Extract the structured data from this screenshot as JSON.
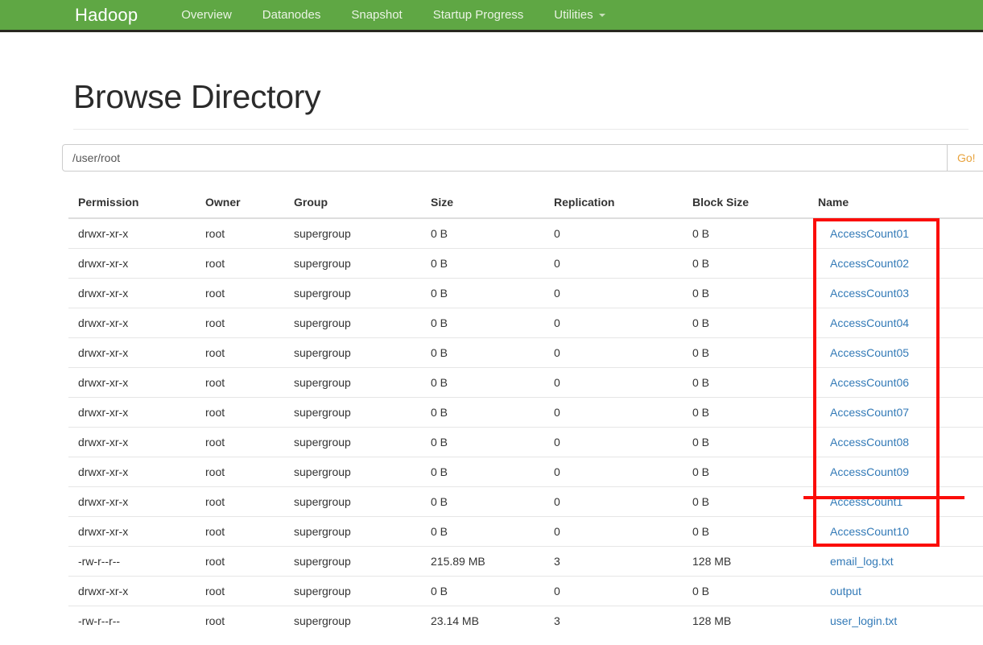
{
  "navbar": {
    "brand": "Hadoop",
    "items": [
      {
        "label": "Overview",
        "caret": false
      },
      {
        "label": "Datanodes",
        "caret": false
      },
      {
        "label": "Snapshot",
        "caret": false
      },
      {
        "label": "Startup Progress",
        "caret": false
      },
      {
        "label": "Utilities",
        "caret": true
      }
    ],
    "background_color": "#5fa744",
    "text_color": "#eaf3e4"
  },
  "page": {
    "title": "Browse Directory"
  },
  "path_bar": {
    "value": "/user/root",
    "placeholder": "",
    "go_button_label": "Go!"
  },
  "table": {
    "headers": [
      "Permission",
      "Owner",
      "Group",
      "Size",
      "Replication",
      "Block Size",
      "Name"
    ],
    "rows": [
      {
        "permission": "drwxr-xr-x",
        "owner": "root",
        "group": "supergroup",
        "size": "0 B",
        "replication": "0",
        "block_size": "0 B",
        "name": "AccessCount01"
      },
      {
        "permission": "drwxr-xr-x",
        "owner": "root",
        "group": "supergroup",
        "size": "0 B",
        "replication": "0",
        "block_size": "0 B",
        "name": "AccessCount02"
      },
      {
        "permission": "drwxr-xr-x",
        "owner": "root",
        "group": "supergroup",
        "size": "0 B",
        "replication": "0",
        "block_size": "0 B",
        "name": "AccessCount03"
      },
      {
        "permission": "drwxr-xr-x",
        "owner": "root",
        "group": "supergroup",
        "size": "0 B",
        "replication": "0",
        "block_size": "0 B",
        "name": "AccessCount04"
      },
      {
        "permission": "drwxr-xr-x",
        "owner": "root",
        "group": "supergroup",
        "size": "0 B",
        "replication": "0",
        "block_size": "0 B",
        "name": "AccessCount05"
      },
      {
        "permission": "drwxr-xr-x",
        "owner": "root",
        "group": "supergroup",
        "size": "0 B",
        "replication": "0",
        "block_size": "0 B",
        "name": "AccessCount06"
      },
      {
        "permission": "drwxr-xr-x",
        "owner": "root",
        "group": "supergroup",
        "size": "0 B",
        "replication": "0",
        "block_size": "0 B",
        "name": "AccessCount07"
      },
      {
        "permission": "drwxr-xr-x",
        "owner": "root",
        "group": "supergroup",
        "size": "0 B",
        "replication": "0",
        "block_size": "0 B",
        "name": "AccessCount08"
      },
      {
        "permission": "drwxr-xr-x",
        "owner": "root",
        "group": "supergroup",
        "size": "0 B",
        "replication": "0",
        "block_size": "0 B",
        "name": "AccessCount09"
      },
      {
        "permission": "drwxr-xr-x",
        "owner": "root",
        "group": "supergroup",
        "size": "0 B",
        "replication": "0",
        "block_size": "0 B",
        "name": "AccessCount1"
      },
      {
        "permission": "drwxr-xr-x",
        "owner": "root",
        "group": "supergroup",
        "size": "0 B",
        "replication": "0",
        "block_size": "0 B",
        "name": "AccessCount10"
      },
      {
        "permission": "-rw-r--r--",
        "owner": "root",
        "group": "supergroup",
        "size": "215.89 MB",
        "replication": "3",
        "block_size": "128 MB",
        "name": "email_log.txt"
      },
      {
        "permission": "drwxr-xr-x",
        "owner": "root",
        "group": "supergroup",
        "size": "0 B",
        "replication": "0",
        "block_size": "0 B",
        "name": "output"
      },
      {
        "permission": "-rw-r--r--",
        "owner": "root",
        "group": "supergroup",
        "size": "23.14 MB",
        "replication": "3",
        "block_size": "128 MB",
        "name": "user_login.txt"
      }
    ]
  },
  "annotations": {
    "box_color": "#fb0d09",
    "strike_color": "#fb0d09"
  }
}
